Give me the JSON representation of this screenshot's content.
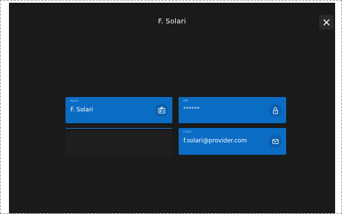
{
  "window": {
    "title": "F. Solari"
  },
  "close": {
    "label": "×"
  },
  "fields": {
    "name": {
      "caption": "Name",
      "value": "F. Solari",
      "icon": "id-card-icon"
    },
    "pin": {
      "caption": "PIN",
      "value": "******",
      "icon": "lock-icon"
    },
    "email": {
      "caption": "E-Mail",
      "value": "f.solari@provider.com",
      "icon": "mail-icon"
    }
  },
  "colors": {
    "background": "#1a1a1a",
    "card": "#0b6cc4",
    "icon_circle": "#0a5fae",
    "text": "#ffffff"
  }
}
